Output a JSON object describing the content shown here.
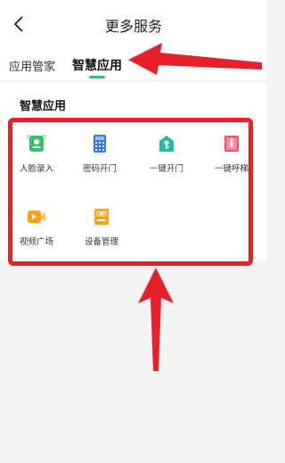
{
  "header": {
    "title": "更多服务"
  },
  "tabs": [
    {
      "label": "应用管家",
      "active": false
    },
    {
      "label": "智慧应用",
      "active": true
    }
  ],
  "section": {
    "title": "智慧应用"
  },
  "apps": [
    {
      "label": "人脸录入",
      "icon": "face-enroll-icon",
      "color": "#34c069"
    },
    {
      "label": "密码开门",
      "icon": "keypad-icon",
      "color": "#2f77ea"
    },
    {
      "label": "一键开门",
      "icon": "key-icon",
      "color": "#1fbfa6"
    },
    {
      "label": "一键呼梯",
      "icon": "elevator-icon",
      "color": "#f0506e"
    },
    {
      "label": "视频广场",
      "icon": "video-icon",
      "color": "#f8a11a"
    },
    {
      "label": "设备管理",
      "icon": "device-icon",
      "color": "#f3a21d"
    }
  ],
  "accent_color": "#1fbfa6",
  "annotation_color": "#e8202a"
}
